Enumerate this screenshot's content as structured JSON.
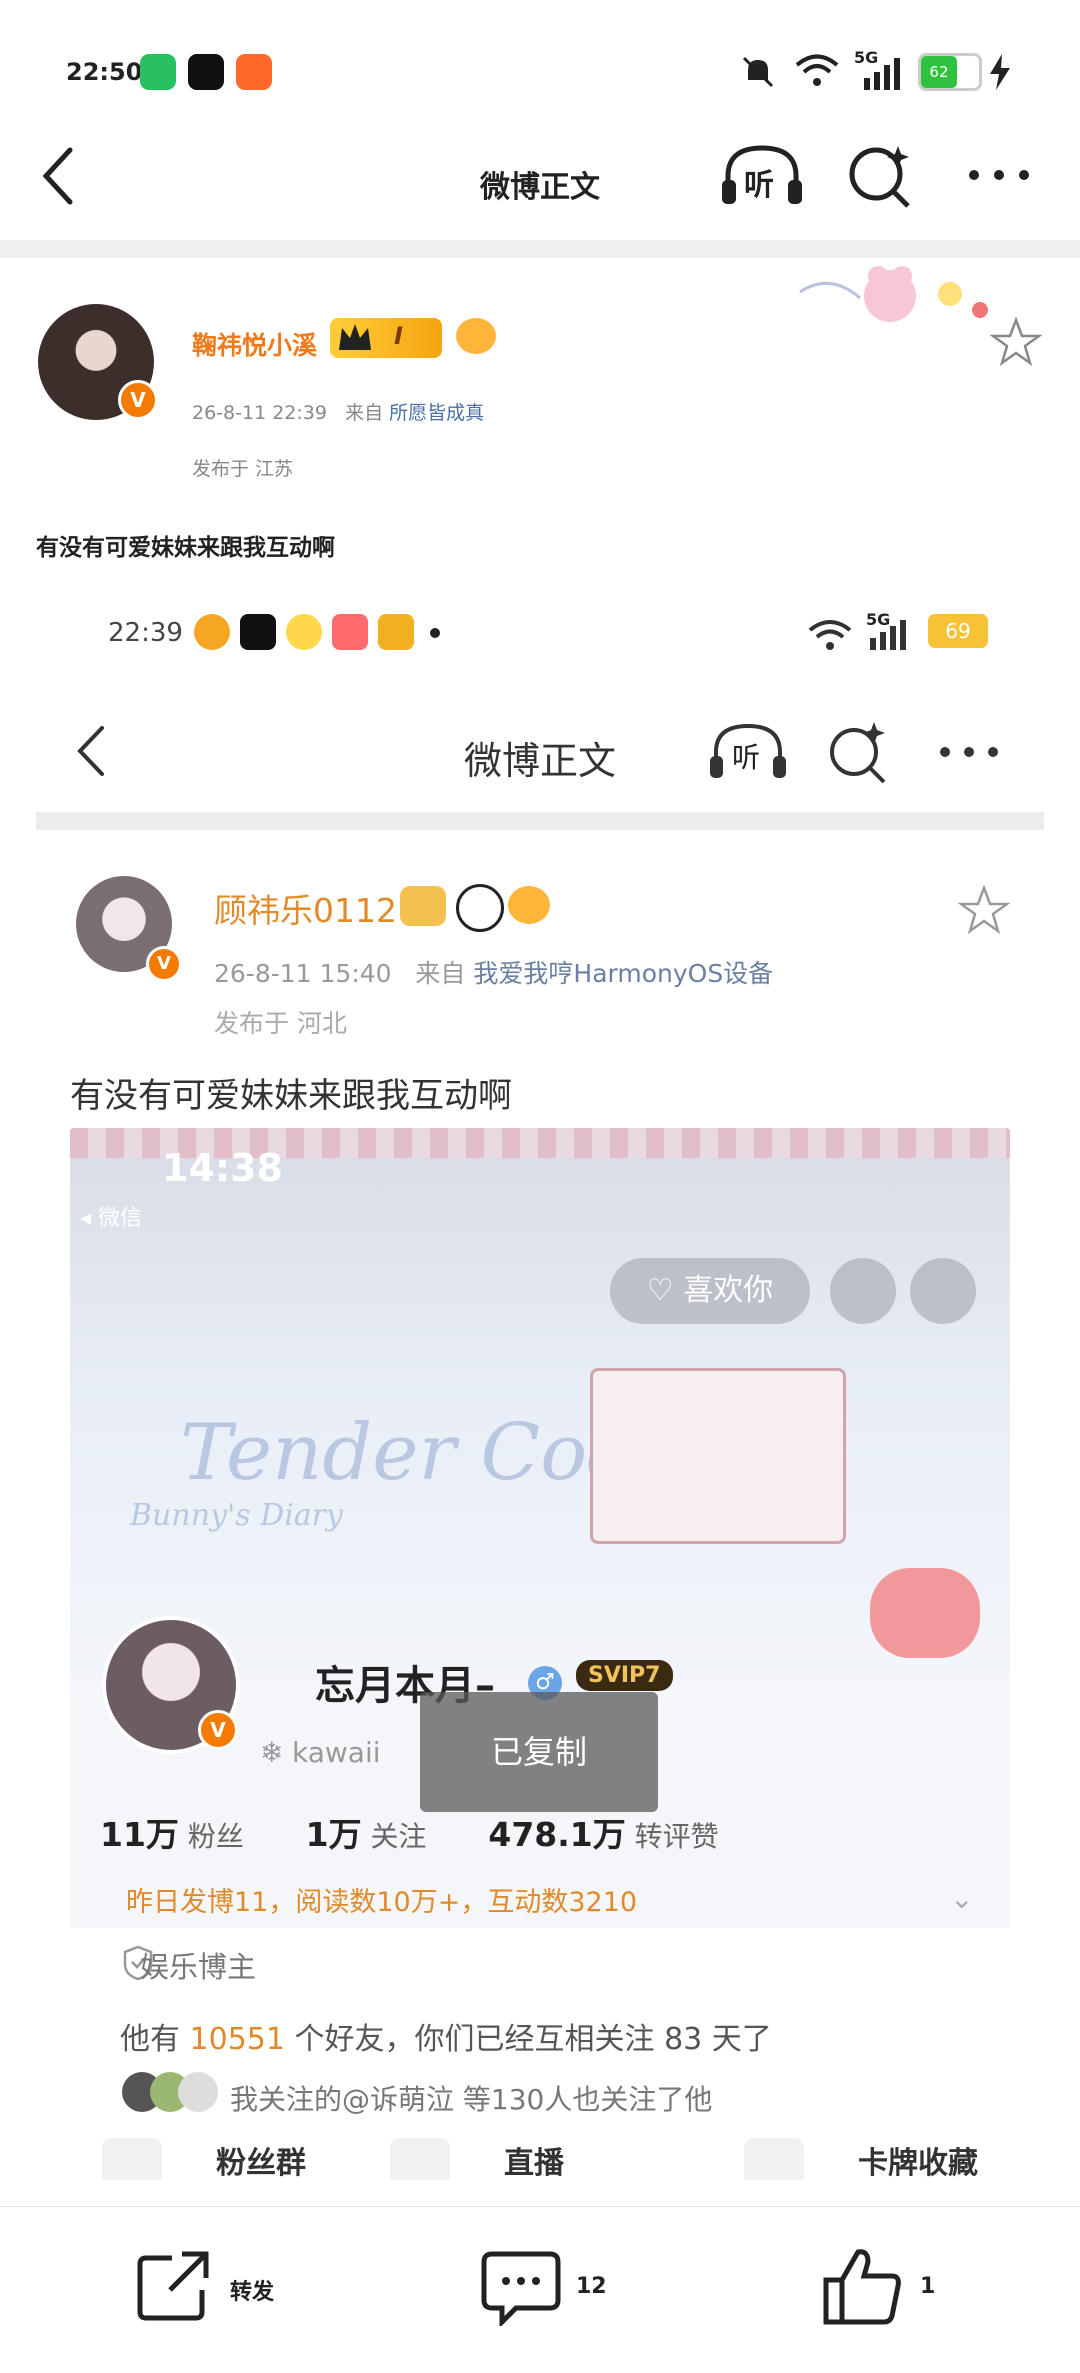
{
  "status_bar": {
    "time": "22:50",
    "battery": "62",
    "network": "5G",
    "icons": [
      "wechat-icon",
      "douyin-icon",
      "kuaishou-icon",
      "mute-bell-icon",
      "wifi-icon",
      "signal-icon",
      "charging-icon"
    ]
  },
  "nav": {
    "title": "微博正文",
    "listen_label": "听",
    "icons": [
      "back-icon",
      "listen-icon",
      "search-sparkle-icon",
      "more-icon"
    ]
  },
  "post": {
    "author": "鞠祎悦小溪",
    "verified": "V",
    "badge": "I",
    "date": "26-8-11 22:39",
    "source_prefix": "来自",
    "source": "所愿皆成真",
    "location": "发布于  江苏",
    "text": "有没有可爱妹妹来跟我互动啊"
  },
  "embedded": {
    "status_time": "22:39",
    "battery": "69",
    "network": "5G",
    "title": "微博正文",
    "listen_label": "听",
    "author": "顾祎乐0112",
    "verified": "V",
    "date": "26-8-11 15:40",
    "source_prefix": "来自",
    "source": "我爱我哼HarmonyOS设备",
    "location": "发布于  河北",
    "text": "有没有可爱妹妹来跟我互动啊",
    "image": {
      "time": "14:38",
      "back_app": "◂ 微信",
      "like_label": "喜欢你",
      "deco_title": "Tender Code",
      "deco_subtitle": "Bunny's Diary",
      "profile_name": "忘月本月–",
      "vip_badge": "SVIP7",
      "kawaii_text": "kawaii",
      "copied_toast": "已复制",
      "stats": [
        {
          "num": "11万",
          "label": "粉丝"
        },
        {
          "num": "1万",
          "label": "关注"
        },
        {
          "num": "478.1万",
          "label": "转评赞"
        }
      ],
      "daily": "昨日发博11，阅读数10万+，互动数3210",
      "entertainment": "娱乐博主",
      "friends_prefix": "他有",
      "friends_count": "10551",
      "friends_suffix": "个好友，你们已经互相关注 83 天了",
      "mutual": "我关注的@诉萌泣 等130人也关注了他",
      "tiles": [
        "粉丝群",
        "直播",
        "卡牌收藏"
      ]
    }
  },
  "bottom_bar": {
    "repost_label": "转发",
    "comment_count": "12",
    "like_count": "1"
  },
  "colors": {
    "orange": "#f07a1a",
    "link": "#4a6fa5",
    "divider": "#f0f0f0"
  }
}
